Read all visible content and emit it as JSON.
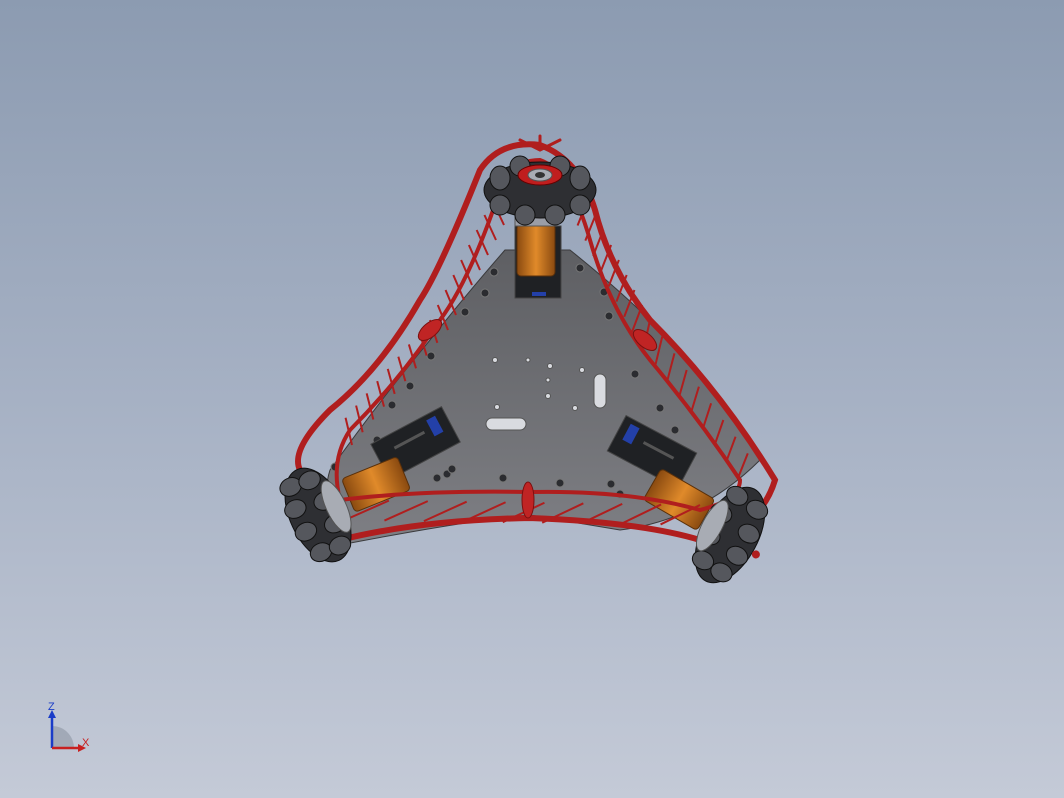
{
  "viewport": {
    "background_top": "#8c9bb1",
    "background_bottom": "#c4cad7"
  },
  "model": {
    "frame_color": "#b01e1e",
    "plate_color": "#6e6e72",
    "motor_color": "#c9741c",
    "wheel_color": "#2e2f33",
    "hub_color": "#a8acb4",
    "controller_color": "#1f2124",
    "wheels": [
      "top-wheel",
      "left-wheel",
      "right-wheel"
    ],
    "motors": [
      "top-motor",
      "left-motor",
      "right-motor"
    ]
  },
  "triad": {
    "z_label": "Z",
    "x_label": "X",
    "z_color": "#1a3cc8",
    "x_color": "#c82020"
  }
}
